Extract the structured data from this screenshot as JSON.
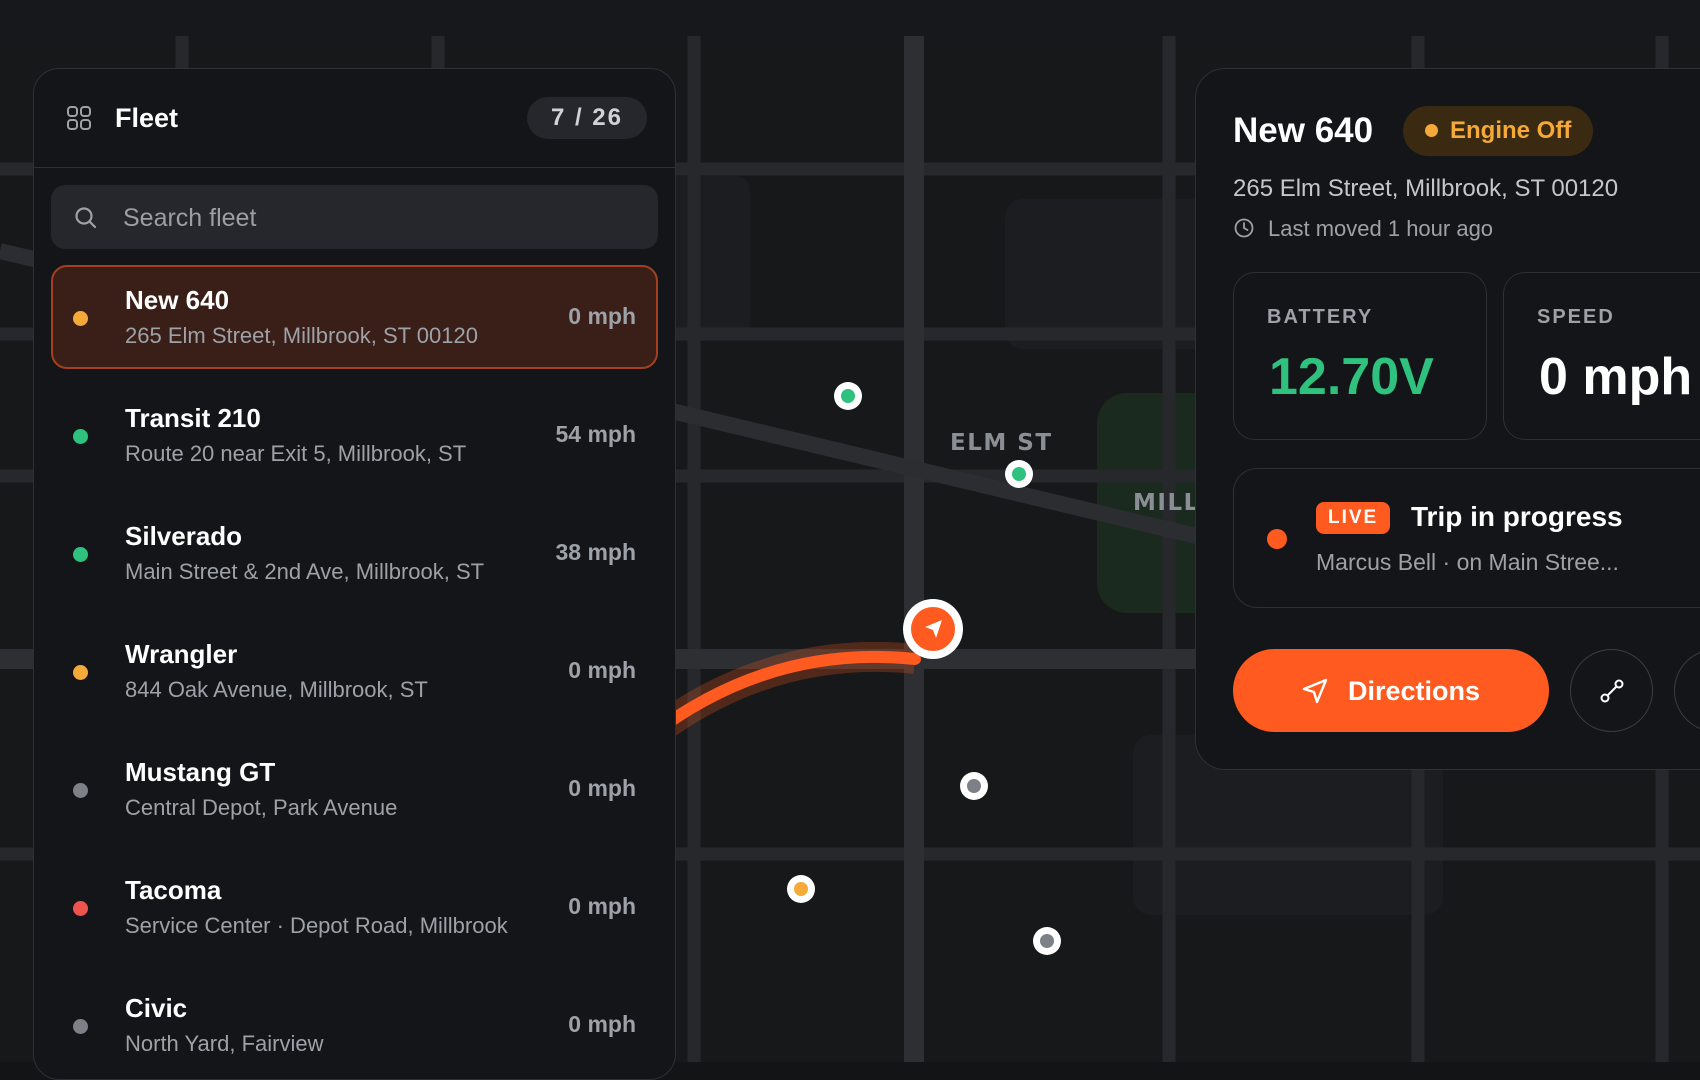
{
  "fleet": {
    "title": "Fleet",
    "count_label": "7 / 26",
    "search_placeholder": "Search fleet",
    "vehicles": [
      {
        "name": "New 640",
        "address": "265 Elm Street, Millbrook, ST 00120",
        "speed": "0 mph",
        "status_color": "#f4a938"
      },
      {
        "name": "Transit 210",
        "address": "Route 20 near Exit 5, Millbrook, ST",
        "speed": "54 mph",
        "status_color": "#2ec27e"
      },
      {
        "name": "Silverado",
        "address": "Main Street & 2nd Ave, Millbrook, ST",
        "speed": "38 mph",
        "status_color": "#2ec27e"
      },
      {
        "name": "Wrangler",
        "address": "844 Oak Avenue, Millbrook, ST",
        "speed": "0 mph",
        "status_color": "#f4a938"
      },
      {
        "name": "Mustang GT",
        "address": "Central Depot, Park Avenue",
        "speed": "0 mph",
        "status_color": "#7d8087"
      },
      {
        "name": "Tacoma",
        "address": "Service Center · Depot Road, Millbrook",
        "speed": "0 mph",
        "status_color": "#ef5350"
      },
      {
        "name": "Civic",
        "address": "North Yard, Fairview",
        "speed": "0 mph",
        "status_color": "#7d8087"
      }
    ]
  },
  "map": {
    "labels": {
      "elm": "ELM ST",
      "mill": "MILL"
    }
  },
  "detail": {
    "title": "New 640",
    "engine_status": "Engine Off",
    "address": "265 Elm Street, Millbrook, ST 00120",
    "last_moved": "Last moved 1 hour ago",
    "battery_label": "BATTERY",
    "battery_value": "12.70V",
    "speed_label": "SPEED",
    "speed_value": "0 mph",
    "live_badge": "LIVE",
    "trip_title": "Trip in progress",
    "trip_subtitle": "Marcus Bell · on Main Stree...",
    "directions_label": "Directions"
  },
  "colors": {
    "accent": "#ff5a1f",
    "battery": "#2ec27e",
    "engine_off": "#f4a938"
  }
}
